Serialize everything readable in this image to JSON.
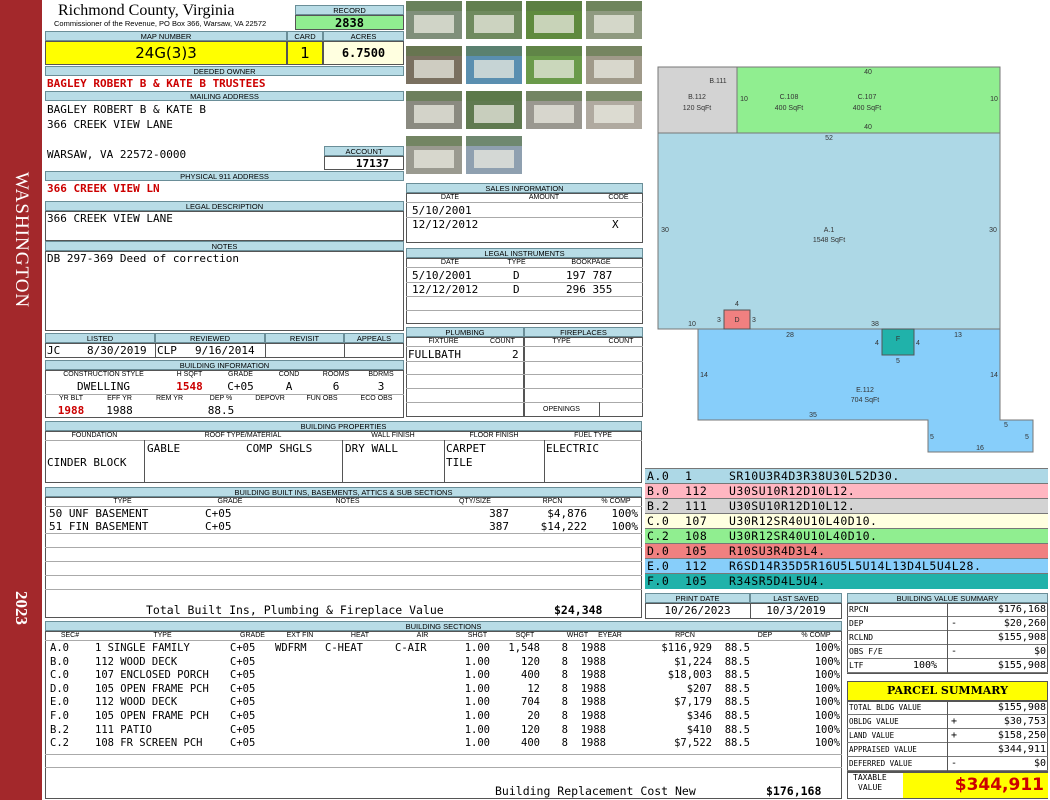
{
  "sidebar": {
    "district": "WASHINGTON",
    "year": "2023",
    "color": "#a3282b"
  },
  "header": {
    "county": "Richmond County, Virginia",
    "address": "Commissioner of the Revenue, PO Box 366, Warsaw, VA 22572"
  },
  "record": {
    "label": "RECORD",
    "value": "2838"
  },
  "map": {
    "label": "MAP NUMBER",
    "value": "24G(3)3"
  },
  "card": {
    "label": "CARD",
    "value": "1"
  },
  "acres": {
    "label": "ACRES",
    "value": "6.7500"
  },
  "owner": {
    "label": "DEEDED OWNER",
    "value": "BAGLEY ROBERT B & KATE B TRUSTEES"
  },
  "mailing": {
    "label": "MAILING ADDRESS",
    "line1": "BAGLEY ROBERT B & KATE B",
    "line2": "366 CREEK VIEW LANE",
    "line3": "WARSAW, VA 22572-0000"
  },
  "account": {
    "label": "ACCOUNT",
    "value": "17137"
  },
  "physical": {
    "label": "PHYSICAL 911 ADDRESS",
    "value": "366 CREEK VIEW LN"
  },
  "legal": {
    "label": "LEGAL DESCRIPTION",
    "value": "366 CREEK VIEW LANE"
  },
  "notes": {
    "label": "NOTES",
    "value": "DB 297-369 Deed of correction"
  },
  "review": {
    "listed_label": "LISTED",
    "reviewed_label": "REVIEWED",
    "revisit_label": "REVISIT",
    "appeals_label": "APPEALS",
    "listed_by": "JC",
    "listed_date": "8/30/2019",
    "reviewed_by": "CLP",
    "reviewed_date": "9/16/2014"
  },
  "building_info": {
    "label": "BUILDING INFORMATION",
    "headers": [
      "CONSTRUCTION STYLE",
      "H SQFT",
      "GRADE",
      "COND",
      "ROOMS",
      "BDRMS"
    ],
    "style": "DWELLING",
    "hsqft": "1548",
    "grade": "C+05",
    "cond": "A",
    "rooms": "6",
    "bdrms": "3",
    "headers2": [
      "YR BLT",
      "EFF YR",
      "REM YR",
      "DEP %",
      "DEPOVR",
      "FUN OBS",
      "ECO OBS"
    ],
    "yrblt": "1988",
    "effyr": "1988",
    "dep": "88.5"
  },
  "sales": {
    "label": "SALES INFORMATION",
    "headers": [
      "DATE",
      "AMOUNT",
      "CODE"
    ],
    "rows": [
      {
        "date": "5/10/2001",
        "amount": "",
        "code": ""
      },
      {
        "date": "12/12/2012",
        "amount": "",
        "code": "X"
      }
    ]
  },
  "instruments": {
    "label": "LEGAL INSTRUMENTS",
    "headers": [
      "DATE",
      "TYPE",
      "BOOKPAGE"
    ],
    "rows": [
      {
        "date": "5/10/2001",
        "type": "D",
        "book": "197 787"
      },
      {
        "date": "12/12/2012",
        "type": "D",
        "book": "296 355"
      }
    ]
  },
  "plumbing": {
    "label": "PLUMBING",
    "headers": [
      "FIXTURE",
      "COUNT"
    ],
    "fixture": "FULLBATH",
    "count": "2"
  },
  "fireplaces": {
    "label": "FIREPLACES",
    "headers": [
      "TYPE",
      "COUNT"
    ],
    "openings_label": "OPENINGS"
  },
  "properties": {
    "label": "BUILDING PROPERTIES",
    "headers": [
      "FOUNDATION",
      "ROOF TYPE/MATERIAL",
      "WALL FINISH",
      "FLOOR FINISH",
      "FUEL TYPE"
    ],
    "foundation": "CINDER BLOCK",
    "roof_type": "GABLE",
    "roof_material": "COMP SHGLS",
    "wall": "DRY WALL",
    "floor1": "CARPET",
    "floor2": "TILE",
    "fuel": "ELECTRIC"
  },
  "builtins": {
    "label": "BUILDING BUILT INS, BASEMENTS, ATTICS & SUB SECTIONS",
    "headers": [
      "TYPE",
      "GRADE",
      "NOTES",
      "QTY/SIZE",
      "RPCN",
      "% COMP"
    ],
    "rows": [
      {
        "type": "50 UNF BASEMENT",
        "grade": "C+05",
        "qty": "387",
        "rpcn": "$4,876",
        "comp": "100%"
      },
      {
        "type": "51 FIN BASEMENT",
        "grade": "C+05",
        "qty": "387",
        "rpcn": "$14,222",
        "comp": "100%"
      }
    ],
    "total_label": "Total Built Ins, Plumbing & Fireplace Value",
    "total": "$24,348"
  },
  "sections": {
    "label": "BUILDING SECTIONS",
    "headers": [
      "SEC#",
      "TYPE",
      "GRADE",
      "EXT FIN",
      "HEAT",
      "AIR",
      "SHGT",
      "SQFT",
      "WHGT",
      "EYEAR",
      "RPCN",
      "DEP",
      "% COMP"
    ],
    "rows": [
      {
        "sec": "A.0",
        "type": "1 SINGLE FAMILY",
        "grade": "C+05",
        "ext": "WDFRM",
        "heat": "C-HEAT",
        "air": "C-AIR",
        "shgt": "1.00",
        "sqft": "1,548",
        "whgt": "8",
        "eyear": "1988",
        "rpcn": "$116,929",
        "dep": "88.5",
        "comp": "100%"
      },
      {
        "sec": "B.0",
        "type": "112 WOOD DECK",
        "grade": "C+05",
        "ext": "",
        "heat": "",
        "air": "",
        "shgt": "1.00",
        "sqft": "120",
        "whgt": "8",
        "eyear": "1988",
        "rpcn": "$1,224",
        "dep": "88.5",
        "comp": "100%"
      },
      {
        "sec": "C.0",
        "type": "107 ENCLOSED PORCH",
        "grade": "C+05",
        "ext": "",
        "heat": "",
        "air": "",
        "shgt": "1.00",
        "sqft": "400",
        "whgt": "8",
        "eyear": "1988",
        "rpcn": "$18,003",
        "dep": "88.5",
        "comp": "100%"
      },
      {
        "sec": "D.0",
        "type": "105 OPEN FRAME PCH",
        "grade": "C+05",
        "ext": "",
        "heat": "",
        "air": "",
        "shgt": "1.00",
        "sqft": "12",
        "whgt": "8",
        "eyear": "1988",
        "rpcn": "$207",
        "dep": "88.5",
        "comp": "100%"
      },
      {
        "sec": "E.0",
        "type": "112 WOOD DECK",
        "grade": "C+05",
        "ext": "",
        "heat": "",
        "air": "",
        "shgt": "1.00",
        "sqft": "704",
        "whgt": "8",
        "eyear": "1988",
        "rpcn": "$7,179",
        "dep": "88.5",
        "comp": "100%"
      },
      {
        "sec": "F.0",
        "type": "105 OPEN FRAME PCH",
        "grade": "C+05",
        "ext": "",
        "heat": "",
        "air": "",
        "shgt": "1.00",
        "sqft": "20",
        "whgt": "8",
        "eyear": "1988",
        "rpcn": "$346",
        "dep": "88.5",
        "comp": "100%"
      },
      {
        "sec": "B.2",
        "type": "111 PATIO",
        "grade": "C+05",
        "ext": "",
        "heat": "",
        "air": "",
        "shgt": "1.00",
        "sqft": "120",
        "whgt": "8",
        "eyear": "1988",
        "rpcn": "$410",
        "dep": "88.5",
        "comp": "100%"
      },
      {
        "sec": "C.2",
        "type": "108 FR SCREEN PCH",
        "grade": "C+05",
        "ext": "",
        "heat": "",
        "air": "",
        "shgt": "1.00",
        "sqft": "400",
        "whgt": "8",
        "eyear": "1988",
        "rpcn": "$7,522",
        "dep": "88.5",
        "comp": "100%"
      }
    ],
    "total_label": "Building Replacement Cost New",
    "total": "$176,168"
  },
  "sketch": {
    "b111": "B.111",
    "b112": "B.112",
    "b112sq": "120 SqFt",
    "c108": "C.108",
    "c108sq": "400 SqFt",
    "c107": "C.107",
    "c107sq": "400 SqFt",
    "a1": "A.1",
    "a1sq": "1548 SqFt",
    "d": "D",
    "f": "F",
    "e112": "E.112",
    "e112sq": "704 SqFt",
    "dims": {
      "top40": "40",
      "c10l": "10",
      "c10r": "10",
      "bot40": "40",
      "a52": "52",
      "a30l": "30",
      "a30r": "30",
      "d4": "4",
      "d3l": "3",
      "d3r": "3",
      "a10": "10",
      "a38": "38",
      "a28": "28",
      "f4l": "4",
      "f4r": "4",
      "f5": "5",
      "e13": "13",
      "e14l": "14",
      "e14r": "14",
      "e35": "35",
      "e5a": "5",
      "e16": "16",
      "e5b": "5",
      "e5c": "5"
    }
  },
  "segments": [
    {
      "code": "A.0",
      "num": "1",
      "path": "SR10U3R4D3R38U30L52D30.",
      "color": "#add8e6"
    },
    {
      "code": "B.0",
      "num": "112",
      "path": "U30SU10R12D10L12.",
      "color": "#ffb6c1"
    },
    {
      "code": "B.2",
      "num": "111",
      "path": "U30SU10R12D10L12.",
      "color": "#d3d3d3"
    },
    {
      "code": "C.0",
      "num": "107",
      "path": "U30R12SR40U10L40D10.",
      "color": "#ffffe0"
    },
    {
      "code": "C.2",
      "num": "108",
      "path": "U30R12SR40U10L40D10.",
      "color": "#90ee90"
    },
    {
      "code": "D.0",
      "num": "105",
      "path": "R10SU3R4D3L4.",
      "color": "#f08080"
    },
    {
      "code": "E.0",
      "num": "112",
      "path": "R6SD14R35D5R16U5L5U14L13D4L5U4L28.",
      "color": "#87cefa"
    },
    {
      "code": "F.0",
      "num": "105",
      "path": "R34SR5D4L5U4.",
      "color": "#20b2aa"
    }
  ],
  "dates": {
    "print_label": "PRINT DATE",
    "saved_label": "LAST SAVED",
    "print": "10/26/2023",
    "saved": "10/3/2019"
  },
  "bvs": {
    "label": "BUILDING VALUE SUMMARY",
    "rows": [
      {
        "label": "RPCN",
        "sign": "",
        "pct": "",
        "value": "$176,168"
      },
      {
        "label": "DEP",
        "sign": "-",
        "pct": "",
        "value": "$20,260"
      },
      {
        "label": "RCLND",
        "sign": "",
        "pct": "",
        "value": "$155,908"
      },
      {
        "label": "OBS F/E",
        "sign": "-",
        "pct": "",
        "value": "$0"
      },
      {
        "label": "LTF",
        "sign": "",
        "pct": "100%",
        "value": "$155,908"
      }
    ]
  },
  "parcel": {
    "label": "PARCEL SUMMARY",
    "rows": [
      {
        "label": "TOTAL BLDG VALUE",
        "sign": "",
        "value": "$155,908"
      },
      {
        "label": "OBLDG VALUE",
        "sign": "+",
        "value": "$30,753"
      },
      {
        "label": "LAND VALUE",
        "sign": "+",
        "value": "$158,250"
      },
      {
        "label": "APPRAISED VALUE",
        "sign": "",
        "value": "$344,911"
      },
      {
        "label": "DEFERRED VALUE",
        "sign": "-",
        "value": "$0"
      }
    ],
    "taxable_label1": "TAXABLE",
    "taxable_label2": "VALUE",
    "taxable": "$344,911"
  },
  "photos": [
    {
      "name": "house-photo",
      "color": "#7f8f7a"
    },
    {
      "name": "pond-photo",
      "color": "#6f8a5e"
    },
    {
      "name": "lawn-photo",
      "color": "#5f8a3e"
    },
    {
      "name": "porch-photo",
      "color": "#8f9a80"
    },
    {
      "name": "deck-photo",
      "color": "#7a7060"
    },
    {
      "name": "pool-photo",
      "color": "#5a8fb0"
    },
    {
      "name": "yard-photo",
      "color": "#6a9a4a"
    },
    {
      "name": "shed-photo",
      "color": "#a09a8a"
    },
    {
      "name": "carport-photo",
      "color": "#8a8a80"
    },
    {
      "name": "driveway-photo",
      "color": "#607a50"
    },
    {
      "name": "garage-photo",
      "color": "#9a9890"
    },
    {
      "name": "outbuilding-photo",
      "color": "#b0aaa0"
    },
    {
      "name": "shelter-photo",
      "color": "#9a9a90"
    },
    {
      "name": "dock-photo",
      "color": "#8fa0b0"
    }
  ]
}
